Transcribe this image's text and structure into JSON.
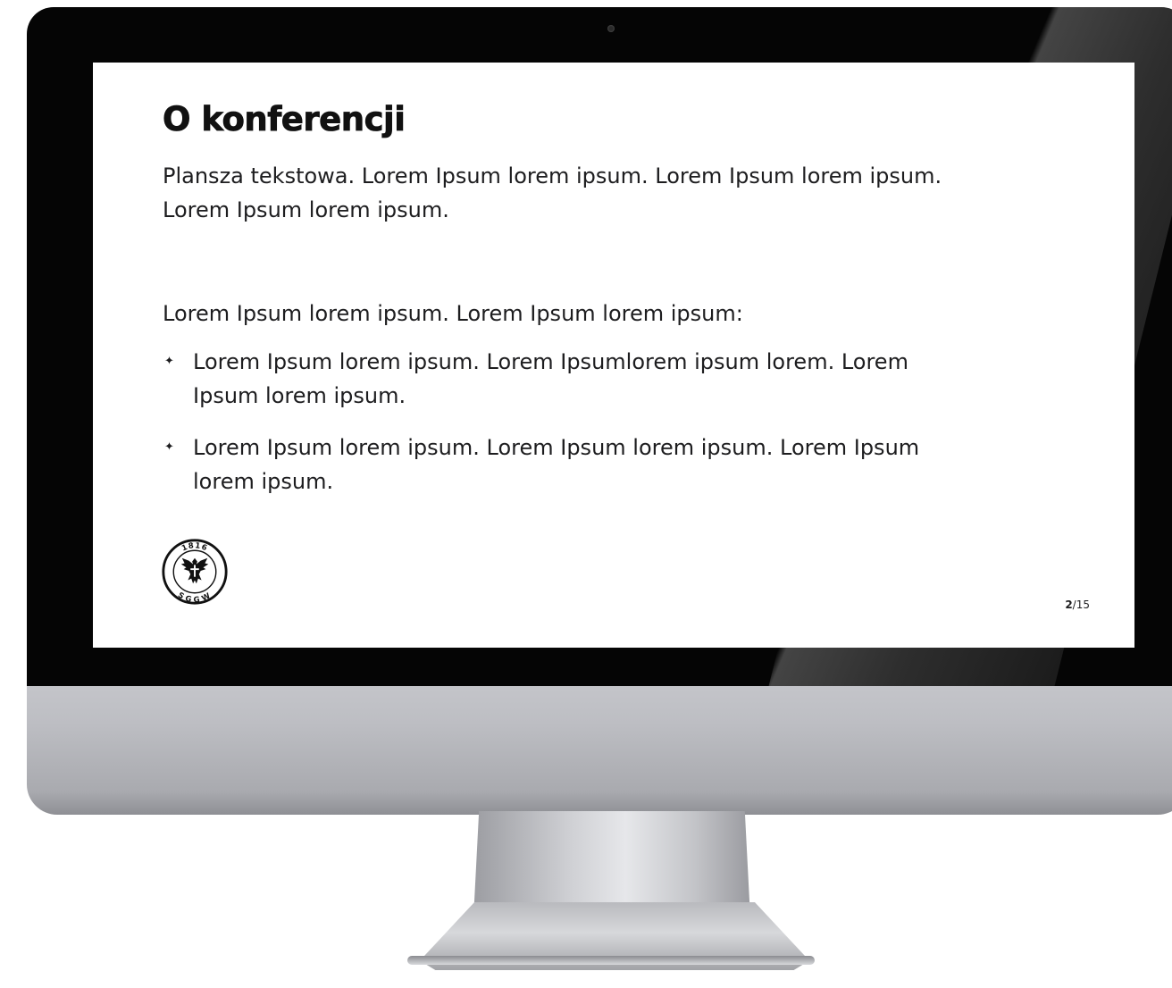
{
  "slide": {
    "title": "O konferencji",
    "intro": "Plansza tekstowa. Lorem Ipsum lorem ipsum. Lorem Ipsum lorem ipsum. Lorem Ipsum lorem ipsum.",
    "lead": "Lorem Ipsum lorem ipsum. Lorem Ipsum lorem ipsum:",
    "bullets": [
      "Lorem Ipsum lorem ipsum. Lorem Ipsumlorem ipsum lorem. Lorem Ipsum lorem ipsum.",
      "Lorem Ipsum lorem ipsum. Lorem Ipsum lorem ipsum. Lorem Ipsum lorem ipsum."
    ],
    "bullet_icon": "✦",
    "logo": {
      "icon": "university-emblem-icon",
      "text_top": "1816",
      "text_bottom": "SGGW"
    },
    "page": {
      "current": "2",
      "separator": "/",
      "total": "15"
    }
  },
  "colors": {
    "bezel": "#050505",
    "aluminum": "#c0c1c6",
    "slide_background": "#ffffff",
    "text": "#1d1d1f"
  }
}
